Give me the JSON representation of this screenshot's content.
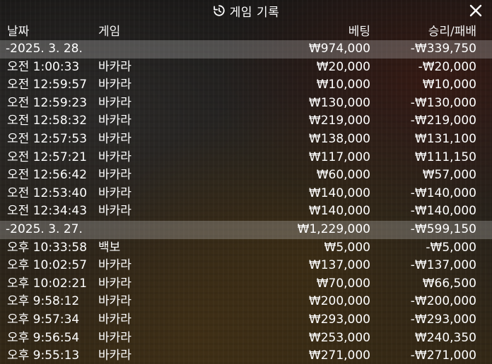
{
  "title": "게임 기록",
  "icons": {
    "title": "history-icon",
    "close": "close-icon"
  },
  "columns": {
    "date": "날짜",
    "game": "게임",
    "bet": "베팅",
    "win_loss": "승리/패배"
  },
  "rows": [
    {
      "type": "group",
      "date": "-2025. 3. 28.",
      "game": "",
      "bet": "₩974,000",
      "win_loss": "-₩339,750"
    },
    {
      "type": "entry",
      "date": "오전 1:00:33",
      "game": "바카라",
      "bet": "₩20,000",
      "win_loss": "-₩20,000"
    },
    {
      "type": "entry",
      "date": "오전 12:59:57",
      "game": "바카라",
      "bet": "₩10,000",
      "win_loss": "₩10,000"
    },
    {
      "type": "entry",
      "date": "오전 12:59:23",
      "game": "바카라",
      "bet": "₩130,000",
      "win_loss": "-₩130,000"
    },
    {
      "type": "entry",
      "date": "오전 12:58:32",
      "game": "바카라",
      "bet": "₩219,000",
      "win_loss": "-₩219,000"
    },
    {
      "type": "entry",
      "date": "오전 12:57:53",
      "game": "바카라",
      "bet": "₩138,000",
      "win_loss": "₩131,100"
    },
    {
      "type": "entry",
      "date": "오전 12:57:21",
      "game": "바카라",
      "bet": "₩117,000",
      "win_loss": "₩111,150"
    },
    {
      "type": "entry",
      "date": "오전 12:56:42",
      "game": "바카라",
      "bet": "₩60,000",
      "win_loss": "₩57,000"
    },
    {
      "type": "entry",
      "date": "오전 12:53:40",
      "game": "바카라",
      "bet": "₩140,000",
      "win_loss": "-₩140,000"
    },
    {
      "type": "entry",
      "date": "오전 12:34:43",
      "game": "바카라",
      "bet": "₩140,000",
      "win_loss": "-₩140,000"
    },
    {
      "type": "group",
      "date": "-2025. 3. 27.",
      "game": "",
      "bet": "₩1,229,000",
      "win_loss": "-₩599,150"
    },
    {
      "type": "entry",
      "date": "오후 10:33:58",
      "game": "백보",
      "bet": "₩5,000",
      "win_loss": "-₩5,000"
    },
    {
      "type": "entry",
      "date": "오후 10:02:57",
      "game": "바카라",
      "bet": "₩137,000",
      "win_loss": "-₩137,000"
    },
    {
      "type": "entry",
      "date": "오후 10:02:21",
      "game": "바카라",
      "bet": "₩70,000",
      "win_loss": "₩66,500"
    },
    {
      "type": "entry",
      "date": "오후 9:58:12",
      "game": "바카라",
      "bet": "₩200,000",
      "win_loss": "-₩200,000"
    },
    {
      "type": "entry",
      "date": "오후 9:57:34",
      "game": "바카라",
      "bet": "₩293,000",
      "win_loss": "-₩293,000"
    },
    {
      "type": "entry",
      "date": "오후 9:56:54",
      "game": "바카라",
      "bet": "₩253,000",
      "win_loss": "₩240,350"
    },
    {
      "type": "entry",
      "date": "오후 9:55:13",
      "game": "바카라",
      "bet": "₩271,000",
      "win_loss": "-₩271,000"
    }
  ]
}
